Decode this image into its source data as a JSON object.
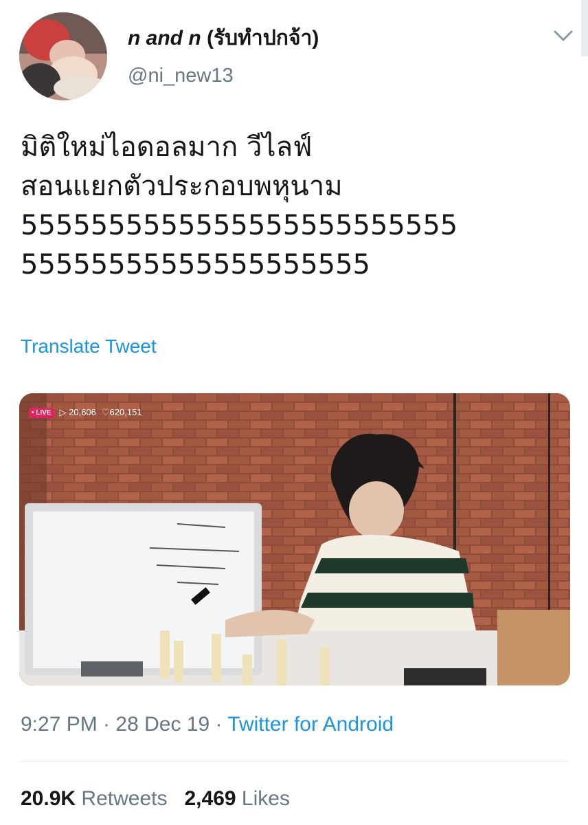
{
  "tweet": {
    "author": {
      "name_latin": "n and n",
      "name_thai": "(รับทำปกจ้า)",
      "handle": "@ni_new13"
    },
    "text_lines": [
      "มิติใหม่ไอดอลมาก วีไลฟ์",
      "สอนแยกตัวประกอบพหุนาม",
      "5555555555555555555555555",
      "55555555555555555555"
    ],
    "translate_label": "Translate Tweet",
    "media": {
      "live_badge": "• LIVE",
      "views": "▷ 20,606",
      "hearts": "♡620,151"
    },
    "timestamp": "9:27 PM · 28 Dec 19 · ",
    "source": "Twitter for Android",
    "stats": {
      "retweets_count": "20.9K",
      "retweets_label": "Retweets",
      "likes_count": "2,469",
      "likes_label": "Likes"
    }
  },
  "colors": {
    "link": "#1b95e0",
    "secondary_text": "#657786",
    "primary_text": "#14171a",
    "divider": "#e6ecf0"
  }
}
